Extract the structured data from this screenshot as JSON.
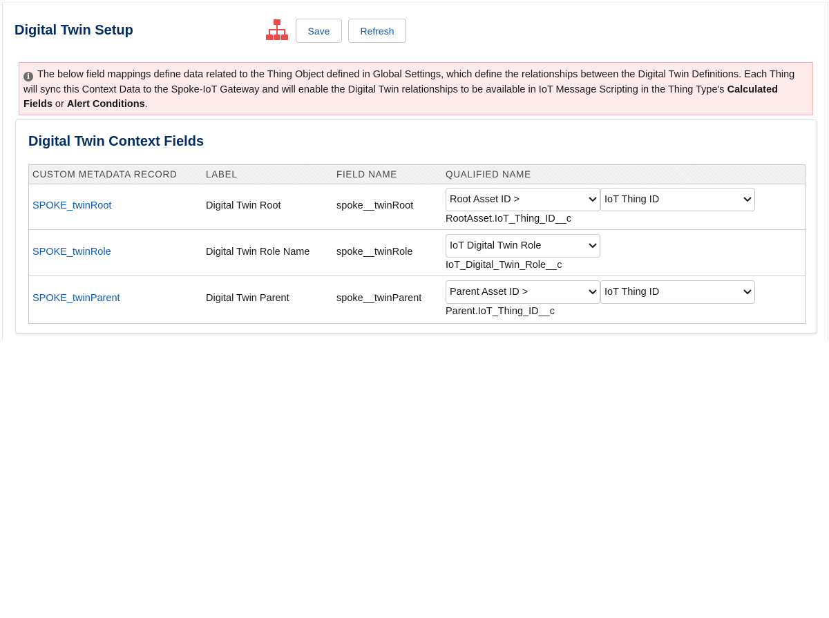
{
  "header": {
    "title": "Digital Twin Setup",
    "icon": "hierarchy-icon",
    "save_label": "Save",
    "refresh_label": "Refresh"
  },
  "banner": {
    "text_before": "The below field mappings define data related to the Thing Object defined in Global Settings, which define the relationships between the Digital Twin Definitions. Each Thing will sync this Context Data to the Spoke-IoT Gateway and will enable the Digital Twin relationships to be available in IoT Message Scripting in the Thing Type's ",
    "bold_1": "Calculated Fields",
    "text_mid": " or ",
    "bold_2": "Alert Conditions",
    "text_end": "."
  },
  "card": {
    "title": "Digital Twin Context Fields",
    "columns": [
      "CUSTOM METADATA RECORD",
      "LABEL",
      "FIELD NAME",
      "QUALIFIED NAME"
    ],
    "rows": [
      {
        "record": "SPOKE_twinRoot",
        "label": "Digital Twin Root",
        "field_name": "spoke__twinRoot",
        "select_1": "Root Asset ID >",
        "select_2": "IoT Thing ID",
        "qualified": "RootAsset.IoT_Thing_ID__c"
      },
      {
        "record": "SPOKE_twinRole",
        "label": "Digital Twin Role Name",
        "field_name": "spoke__twinRole",
        "select_1": "IoT Digital Twin Role",
        "qualified": "IoT_Digital_Twin_Role__c"
      },
      {
        "record": "SPOKE_twinParent",
        "label": "Digital Twin Parent",
        "field_name": "spoke__twinParent",
        "select_1": "Parent Asset ID >",
        "select_2": "IoT Thing ID",
        "qualified": "Parent.IoT_Thing_ID__c"
      }
    ]
  },
  "colors": {
    "title": "#032d60",
    "link": "#0b5cab",
    "icon": "#ea4c4c",
    "banner_bg": "#fdeaea"
  }
}
